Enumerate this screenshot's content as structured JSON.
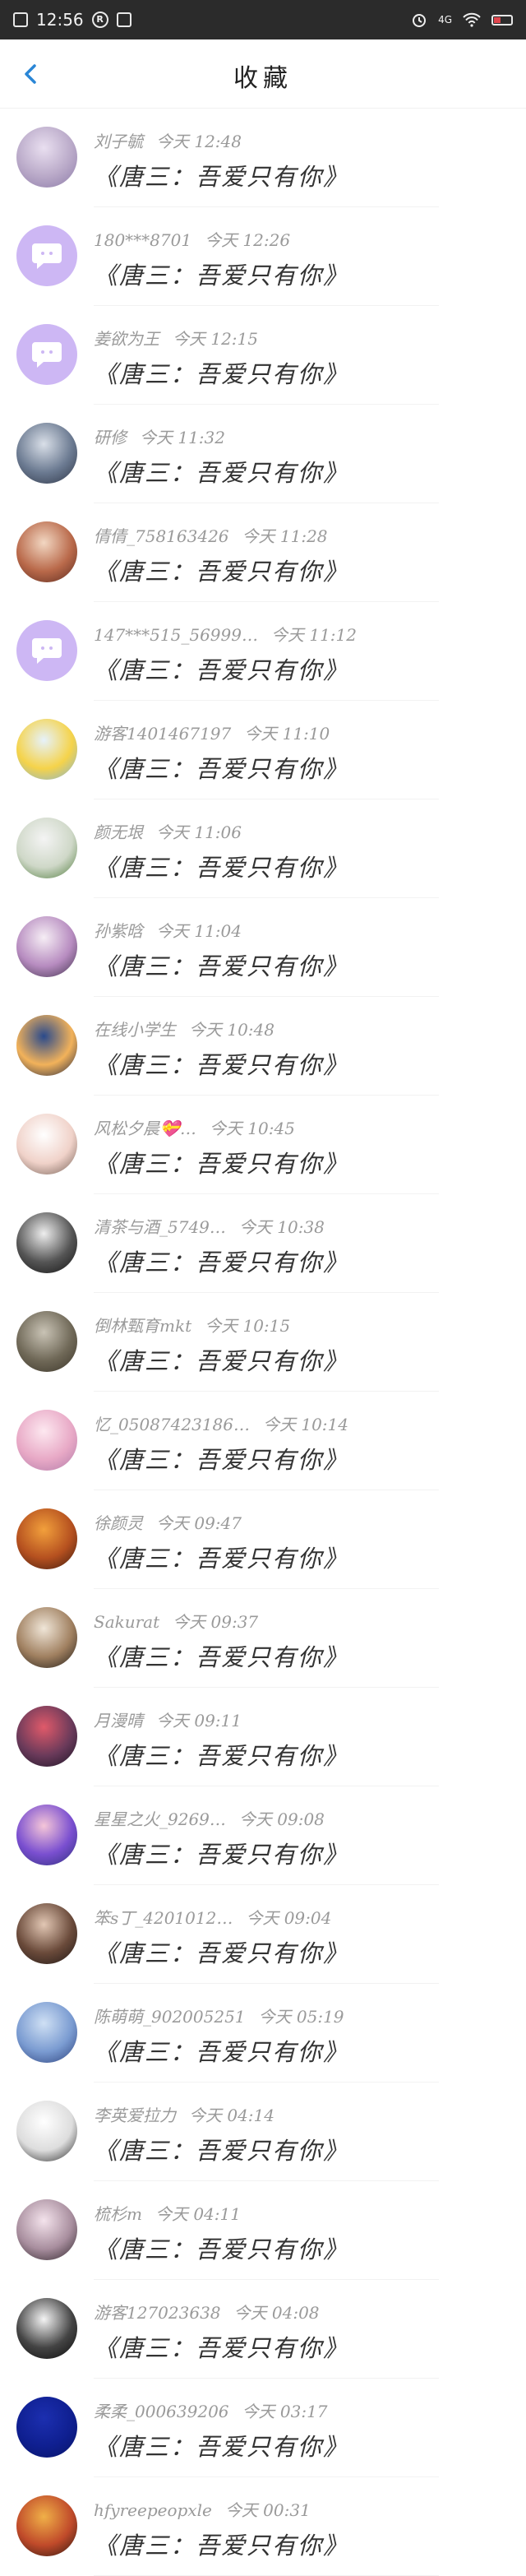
{
  "status_bar": {
    "time": "12:56",
    "signal_text": "4G",
    "icons": [
      "notification-box-icon",
      "r-circle-icon",
      "screenshot-icon",
      "alarm-icon",
      "wifi-icon",
      "battery-icon"
    ]
  },
  "header": {
    "title": "收藏"
  },
  "items": [
    {
      "user": "刘子毓",
      "time": "今天 12:48",
      "title": "《唐三：吾爱只有你》",
      "avatar": {
        "kind": "photo",
        "colors": [
          "#e9dff0",
          "#b9a9c8",
          "#8c7aa8"
        ]
      }
    },
    {
      "user": "180***8701",
      "time": "今天 12:26",
      "title": "《唐三：吾爱只有你》",
      "avatar": {
        "kind": "default"
      }
    },
    {
      "user": "姜欲为王",
      "time": "今天 12:15",
      "title": "《唐三：吾爱只有你》",
      "avatar": {
        "kind": "default"
      }
    },
    {
      "user": "研修",
      "time": "今天 11:32",
      "title": "《唐三：吾爱只有你》",
      "avatar": {
        "kind": "photo",
        "colors": [
          "#d9dfe8",
          "#6b7a91",
          "#2d3445"
        ]
      }
    },
    {
      "user": "倩倩_758163426",
      "time": "今天 11:28",
      "title": "《唐三：吾爱只有你》",
      "avatar": {
        "kind": "photo",
        "colors": [
          "#f2d7c2",
          "#b9694a",
          "#5a2a1f"
        ]
      }
    },
    {
      "user": "147***515_56999…",
      "time": "今天 11:12",
      "title": "《唐三：吾爱只有你》",
      "avatar": {
        "kind": "default"
      }
    },
    {
      "user": "游客1401467197",
      "time": "今天 11:10",
      "title": "《唐三：吾爱只有你》",
      "avatar": {
        "kind": "photo",
        "colors": [
          "#e6f2fb",
          "#f5d34a",
          "#7fb2d8"
        ]
      }
    },
    {
      "user": "颜无垠",
      "time": "今天 11:06",
      "title": "《唐三：吾爱只有你》",
      "avatar": {
        "kind": "photo",
        "colors": [
          "#f4f4f4",
          "#cfd8c8",
          "#4d7a3a"
        ]
      }
    },
    {
      "user": "孙紫晗",
      "time": "今天 11:04",
      "title": "《唐三：吾爱只有你》",
      "avatar": {
        "kind": "photo",
        "colors": [
          "#f6eef5",
          "#b78cc0",
          "#3e2f4a"
        ]
      }
    },
    {
      "user": "在线小学生",
      "time": "今天 10:48",
      "title": "《唐三：吾爱只有你》",
      "avatar": {
        "kind": "photo",
        "colors": [
          "#2a4a8c",
          "#f2b25a",
          "#1c2340"
        ]
      }
    },
    {
      "user": "风松夕晨💝…",
      "time": "今天 10:45",
      "title": "《唐三：吾爱只有你》",
      "avatar": {
        "kind": "photo",
        "colors": [
          "#ffffff",
          "#f0d2c9",
          "#6f5a50"
        ]
      }
    },
    {
      "user": "清茶与酒_5749…",
      "time": "今天 10:38",
      "title": "《唐三：吾爱只有你》",
      "avatar": {
        "kind": "photo",
        "colors": [
          "#eeeeee",
          "#555555",
          "#111111"
        ]
      }
    },
    {
      "user": "倒林甄育mkt",
      "time": "今天 10:15",
      "title": "《唐三：吾爱只有你》",
      "avatar": {
        "kind": "photo",
        "colors": [
          "#c9c3b5",
          "#6f6857",
          "#3a3428"
        ]
      }
    },
    {
      "user": "忆_05087423186…",
      "time": "今天 10:14",
      "title": "《唐三：吾爱只有你》",
      "avatar": {
        "kind": "photo",
        "colors": [
          "#fde8f0",
          "#e8a9c6",
          "#b07aa8"
        ]
      }
    },
    {
      "user": "徐颜灵",
      "time": "今天 09:47",
      "title": "《唐三：吾爱只有你》",
      "avatar": {
        "kind": "photo",
        "colors": [
          "#f2a03c",
          "#b5501f",
          "#3a1a10"
        ]
      }
    },
    {
      "user": "Sakurat",
      "time": "今天 09:37",
      "title": "《唐三：吾爱只有你》",
      "avatar": {
        "kind": "photo",
        "colors": [
          "#f0e6d8",
          "#a08060",
          "#1e1a16"
        ]
      }
    },
    {
      "user": "月漫晴",
      "time": "今天 09:11",
      "title": "《唐三：吾爱只有你》",
      "avatar": {
        "kind": "photo",
        "colors": [
          "#e05a6a",
          "#6a3a5a",
          "#1a1424"
        ]
      }
    },
    {
      "user": "星星之火_9269…",
      "time": "今天 09:08",
      "title": "《唐三：吾爱只有你》",
      "avatar": {
        "kind": "photo",
        "colors": [
          "#f5c6d8",
          "#7a4fd0",
          "#2c2f7a"
        ]
      }
    },
    {
      "user": "笨s丁_4201012…",
      "time": "今天 09:04",
      "title": "《唐三：吾爱只有你》",
      "avatar": {
        "kind": "photo",
        "colors": [
          "#e2c7b4",
          "#6a4a3a",
          "#1d1614"
        ]
      }
    },
    {
      "user": "陈萌萌_902005251",
      "time": "今天 05:19",
      "title": "《唐三：吾爱只有你》",
      "avatar": {
        "kind": "photo",
        "colors": [
          "#cfe0f4",
          "#7a9bd1",
          "#2a3f7a"
        ]
      }
    },
    {
      "user": "李英爱拉力",
      "time": "今天 04:14",
      "title": "《唐三：吾爱只有你》",
      "avatar": {
        "kind": "photo",
        "colors": [
          "#ffffff",
          "#dddddd",
          "#222222"
        ]
      }
    },
    {
      "user": "梳杉m",
      "time": "今天 04:11",
      "title": "《唐三：吾爱只有你》",
      "avatar": {
        "kind": "photo",
        "colors": [
          "#f4e3ec",
          "#a88e9e",
          "#2c2228"
        ]
      }
    },
    {
      "user": "游客127023638",
      "time": "今天 04:08",
      "title": "《唐三：吾爱只有你》",
      "avatar": {
        "kind": "photo",
        "colors": [
          "#f4f4f4",
          "#444444",
          "#0a0a0a"
        ]
      }
    },
    {
      "user": "柔柔_000639206",
      "time": "今天 03:17",
      "title": "《唐三：吾爱只有你》",
      "avatar": {
        "kind": "photo",
        "colors": [
          "#1c2fb0",
          "#0f1f90",
          "#081466"
        ]
      }
    },
    {
      "user": "hfyreepeopxle",
      "time": "今天 00:31",
      "title": "《唐三：吾爱只有你》",
      "avatar": {
        "kind": "photo",
        "colors": [
          "#f0b048",
          "#c04a2a",
          "#2a1610"
        ]
      }
    }
  ]
}
